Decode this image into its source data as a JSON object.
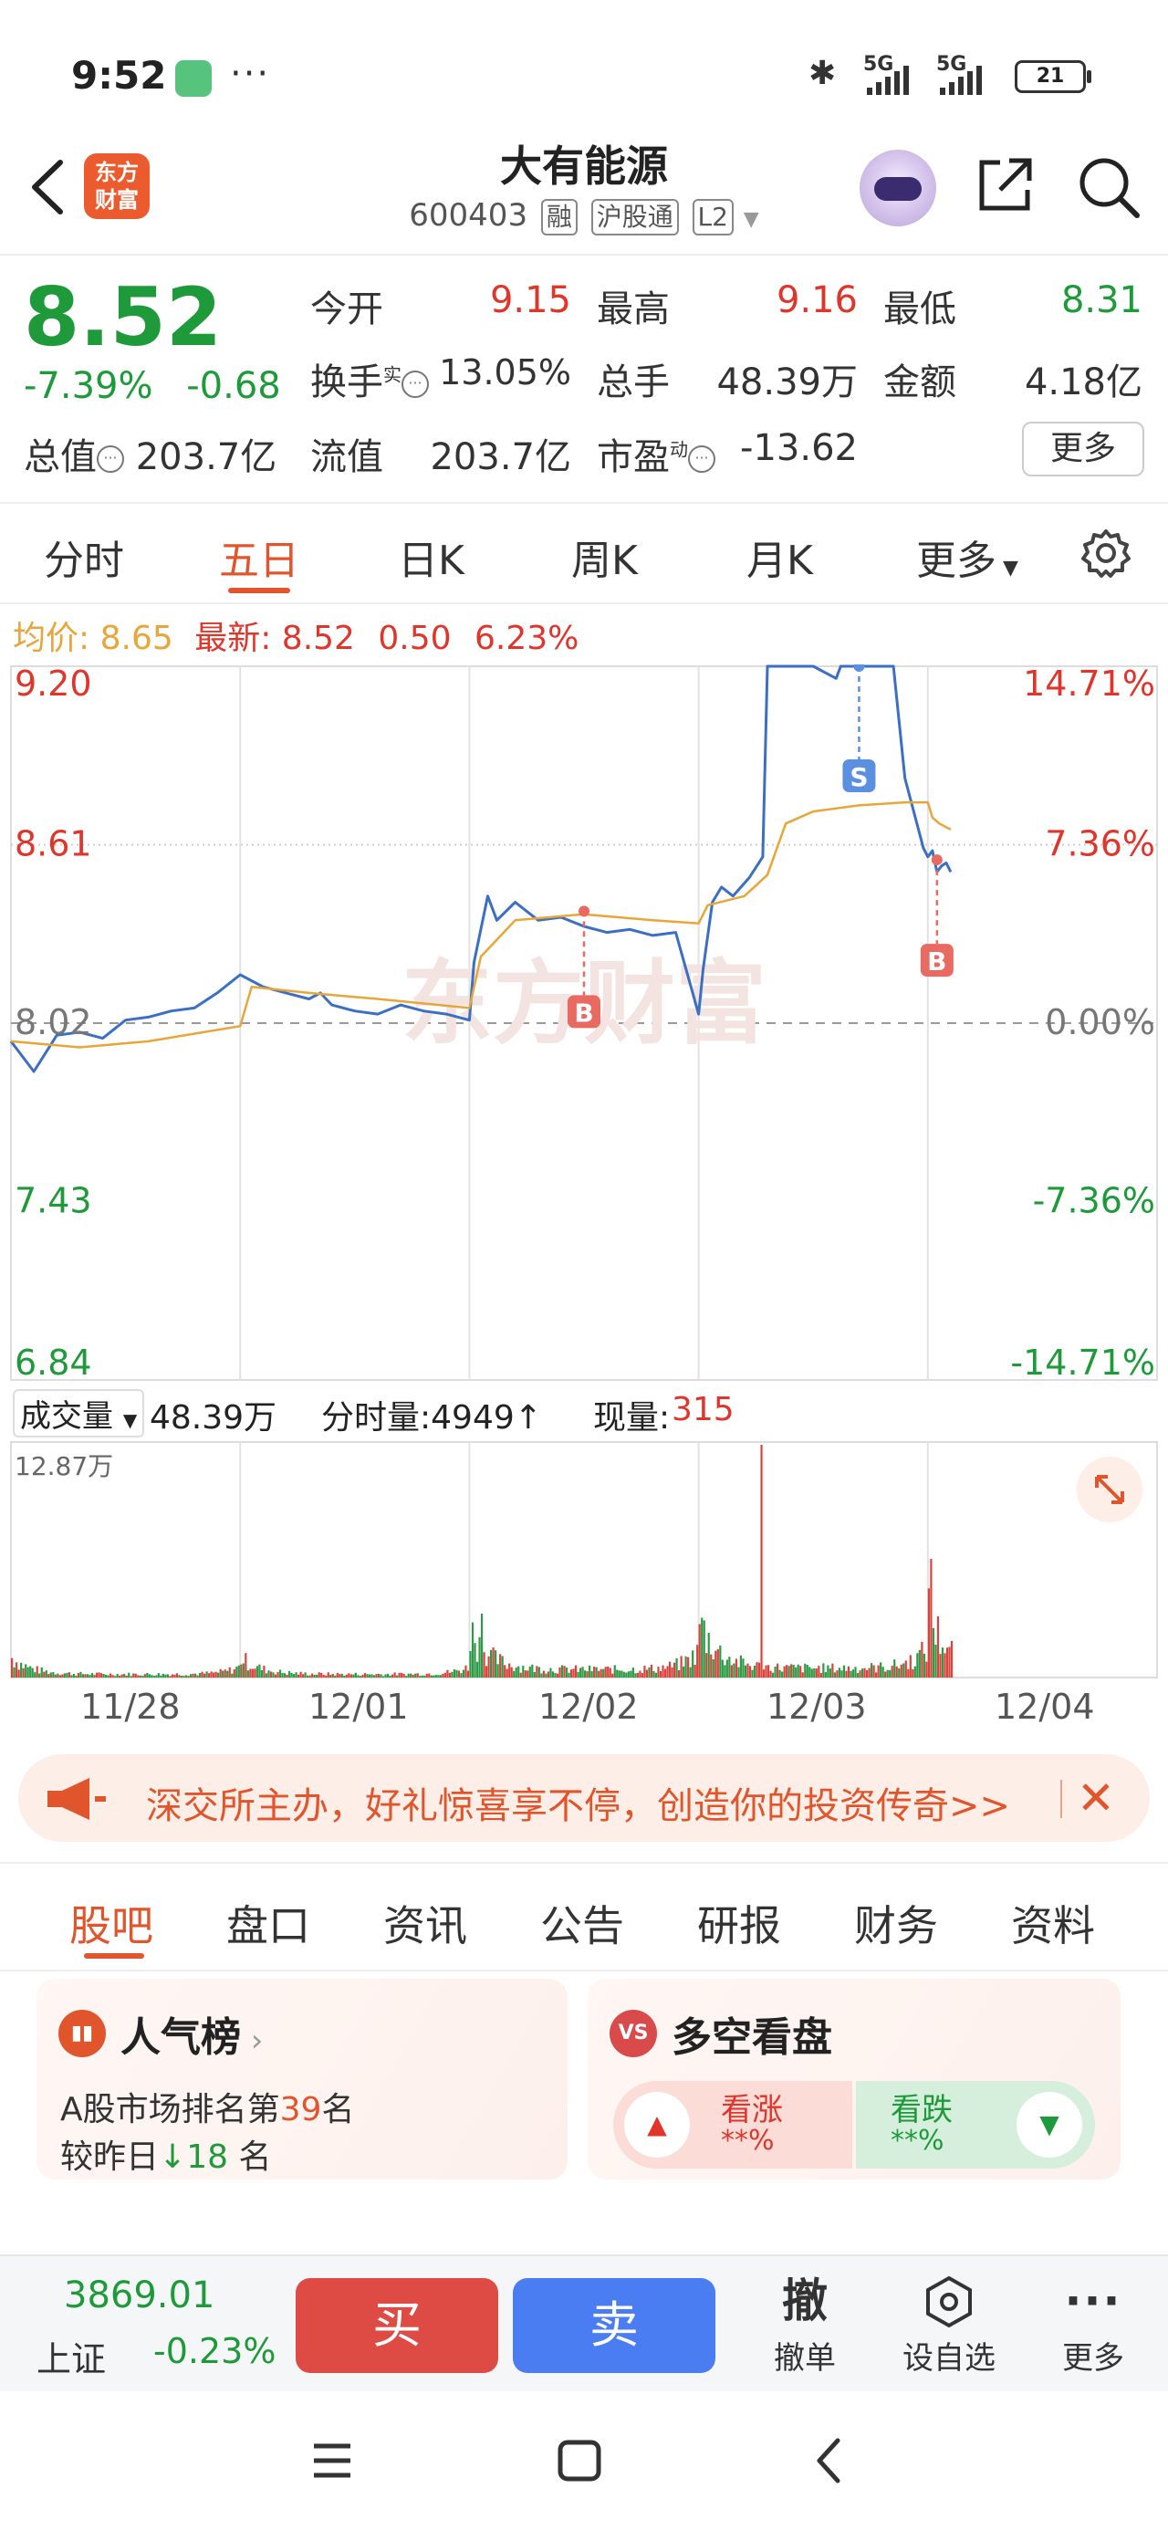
{
  "status": {
    "time": "9:52",
    "dots": "···",
    "net1": "5G",
    "net2": "5G",
    "battery": "21"
  },
  "header": {
    "name": "大有能源",
    "code": "600403",
    "tags": [
      "融",
      "沪股通",
      "L2"
    ],
    "logo_line1": "东方",
    "logo_line2": "财富"
  },
  "quote": {
    "price": "8.52",
    "change_pct": "-7.39%",
    "change": "-0.68",
    "open_label": "今开",
    "open": "9.15",
    "high_label": "最高",
    "high": "9.16",
    "low_label": "最低",
    "low": "8.31",
    "turnover_label": "换手",
    "turnover_sup": "实",
    "turnover": "13.05%",
    "volume_label": "总手",
    "volume": "48.39万",
    "amount_label": "金额",
    "amount": "4.18亿",
    "mktcap_label": "总值",
    "mktcap": "203.7亿",
    "float_label": "流值",
    "float": "203.7亿",
    "pe_label": "市盈",
    "pe_sup": "动",
    "pe": "-13.62",
    "more": "更多"
  },
  "chart_tabs": [
    "分时",
    "五日",
    "日K",
    "周K",
    "月K",
    "更多"
  ],
  "active_chart_tab": "五日",
  "legend": {
    "avg_label": "均价:",
    "avg": "8.65",
    "last_label": "最新:",
    "last": "8.52",
    "chg": "0.50",
    "pct": "6.23%"
  },
  "volume_bar": {
    "label": "成交量",
    "total": "48.39万",
    "tick_label": "分时量:4949↑",
    "now_label": "现量:",
    "now": "315",
    "max": "12.87万"
  },
  "watermark": "东方财富",
  "chart_data": {
    "type": "line",
    "title": "",
    "y_ticks_left": [
      "9.20",
      "8.61",
      "8.02",
      "7.43",
      "6.84"
    ],
    "y_ticks_right": [
      "14.71%",
      "7.36%",
      "0.00%",
      "-7.36%",
      "-14.71%"
    ],
    "ylim": [
      6.84,
      9.2
    ],
    "prev_close": 8.02,
    "x_ticks": [
      "11/28",
      "12/01",
      "12/02",
      "12/03",
      "12/04"
    ],
    "series": [
      {
        "color": "#3b6fc4",
        "x": [
          0,
          0.1,
          0.2,
          0.3,
          0.4,
          0.5,
          0.6,
          0.7,
          0.8,
          0.9,
          1.0,
          1.1,
          1.2,
          1.3,
          1.35,
          1.4,
          1.5,
          1.6,
          1.7,
          1.8,
          1.9,
          2.0,
          2.02,
          2.08,
          2.12,
          2.2,
          2.25,
          2.3,
          2.4,
          2.5,
          2.6,
          2.7,
          2.8,
          2.9,
          3.0,
          3.02,
          3.06,
          3.1,
          3.15,
          3.22,
          3.28,
          3.3,
          3.32,
          3.4,
          3.5,
          3.6,
          3.62,
          3.7,
          3.8,
          3.85,
          3.9,
          3.98,
          4.0,
          4.02,
          4.04,
          4.06,
          4.08,
          4.1
        ],
        "y": [
          7.96,
          7.86,
          7.98,
          7.99,
          7.97,
          8.03,
          8.04,
          8.06,
          8.07,
          8.12,
          8.18,
          8.14,
          8.12,
          8.1,
          8.12,
          8.08,
          8.06,
          8.05,
          8.08,
          8.06,
          8.05,
          8.03,
          8.22,
          8.44,
          8.36,
          8.42,
          8.39,
          8.36,
          8.37,
          8.34,
          8.32,
          8.33,
          8.31,
          8.32,
          8.05,
          8.2,
          8.42,
          8.47,
          8.44,
          8.5,
          8.57,
          9.2,
          9.2,
          9.2,
          9.2,
          9.16,
          9.2,
          9.2,
          9.2,
          9.2,
          8.83,
          8.6,
          8.57,
          8.59,
          8.52,
          8.54,
          8.55,
          8.52
        ]
      },
      {
        "color": "#e8a53a",
        "x": [
          0,
          0.3,
          0.6,
          1.0,
          1.05,
          1.3,
          1.6,
          2.0,
          2.05,
          2.2,
          2.5,
          2.8,
          3.0,
          3.04,
          3.2,
          3.3,
          3.38,
          3.5,
          3.7,
          3.9,
          4.0,
          4.02,
          4.05,
          4.1
        ],
        "y": [
          7.96,
          7.94,
          7.96,
          8.01,
          8.14,
          8.12,
          8.1,
          8.07,
          8.24,
          8.36,
          8.38,
          8.36,
          8.35,
          8.41,
          8.44,
          8.51,
          8.68,
          8.72,
          8.74,
          8.75,
          8.75,
          8.7,
          8.68,
          8.66
        ]
      }
    ],
    "trade_marks": [
      {
        "label": "B",
        "x": 2.5,
        "y": 8.39
      },
      {
        "label": "S",
        "x": 3.7,
        "y": 9.2
      },
      {
        "label": "B",
        "x": 4.04,
        "y": 8.56
      }
    ]
  },
  "banner": {
    "text": "深交所主办，好礼惊喜享不停，创造你的投资传奇>>",
    "close": "✕"
  },
  "bottom_tabs": [
    "股吧",
    "盘口",
    "资讯",
    "公告",
    "研报",
    "财务",
    "资料"
  ],
  "active_bottom_tab": "股吧",
  "popularity": {
    "title": "人气榜",
    "rank_prefix": "A股市场排名第",
    "rank": "39",
    "rank_suffix": "名",
    "change_prefix": "较昨日",
    "change": "18",
    "change_suffix": "名"
  },
  "long_short": {
    "title": "多空看盘",
    "up_label": "看涨",
    "up_value": "**%",
    "down_label": "看跌",
    "down_value": "**%"
  },
  "toolbar": {
    "index_value": "3869.01",
    "index_name": "上证",
    "index_change": "-0.23%",
    "buy": "买",
    "sell": "卖",
    "cancel_glyph": "撤",
    "cancel": "撤单",
    "watch": "设自选",
    "more": "更多"
  }
}
